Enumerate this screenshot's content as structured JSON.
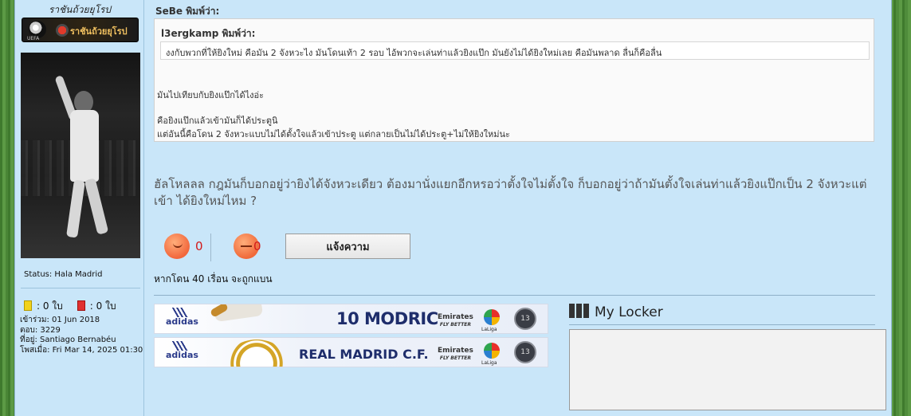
{
  "sidebar": {
    "club_title": "ราชันถ้วยยุโรป",
    "banner_text": "ราชันถ้วยยุโรป",
    "banner_badge_label": "UEFA",
    "status": "Status: Hala Madrid",
    "cards": {
      "yellow": ": 0 ใบ",
      "red": ": 0 ใบ"
    },
    "info": {
      "joined": "เข้าร่วม: 01 Jun 2018",
      "posts": "ตอบ: 3229",
      "location": "ที่อยู่: Santiago Bernabéu",
      "posted": "โพสเมื่อ: Fri Mar 14, 2025 01:30"
    }
  },
  "post": {
    "outer_quote_author": "SeBe พิมพ์ว่า:",
    "inner_quote_author": "l3ergkamp พิมพ์ว่า:",
    "inner_quote_text": "งงกับพวกที่ให้ยิงใหม่ คือมัน 2 จังหวะไง มันโดนเท้า 2 รอบ ไอ้พวกจะเล่นท่าแล้วยิงแป๊ก มันยังไม่ได้ยิงใหม่เลย คือมันพลาด ลื่นก็คือลื่น",
    "outer_lines": [
      "มันไปเทียบกับยิงแป๊กได้ไงอ่ะ",
      "คือยิงแป๊กแล้วเข้ามันก็ได้ประตูนิ",
      "แต่อันนี้คือโดน 2 จังหวะแบบไม่ได้ตั้งใจแล้วเข้าประตู แต่กลายเป็นไม่ได้ประตู+ไม่ให้ยิงใหม่นะ"
    ],
    "body": "ฮัลโหลลล กฎมันก็บอกอยู่ว่ายิงได้จังหวะเดียว ต้องมานั่งแยกอีกหรอว่าตั้งใจไม่ตั้งใจ ก็บอกอยู่ว่าถ้ามันตั้งใจเล่นท่าแล้วยิงแป๊กเป็น 2 จังหวะแต่เข้า ได้ยิงใหม่ไหม ?",
    "like_count": "0",
    "dislike_count": "0",
    "report_label": "แจ้งความ",
    "warning": "หากโดน 40 เรื่อน จะถูกแบน"
  },
  "signature": {
    "banner1": {
      "brand": "adidas",
      "player": "10 MODRIC",
      "sponsor": "Emirates",
      "sponsor_sub": "FLY BETTER",
      "league": "LaLiga",
      "badge": "13"
    },
    "banner2": {
      "brand": "adidas",
      "club": "REAL MADRID C.F.",
      "sponsor": "Emirates",
      "sponsor_sub": "FLY BETTER",
      "league": "LaLiga",
      "badge": "13"
    }
  },
  "locker": {
    "title": "My Locker"
  },
  "colors": {
    "page_bg": "#c9e6f9",
    "reaction_count": "#d21a1a",
    "accent_navy": "#1e2d6b"
  },
  "icons": [
    "ucl-ball-icon",
    "club-badge-icon",
    "yellow-card-icon",
    "red-card-icon",
    "like-face-icon",
    "dislike-face-icon",
    "adidas-icon",
    "laliga-icon",
    "ucl-13-icon",
    "locker-icon"
  ]
}
